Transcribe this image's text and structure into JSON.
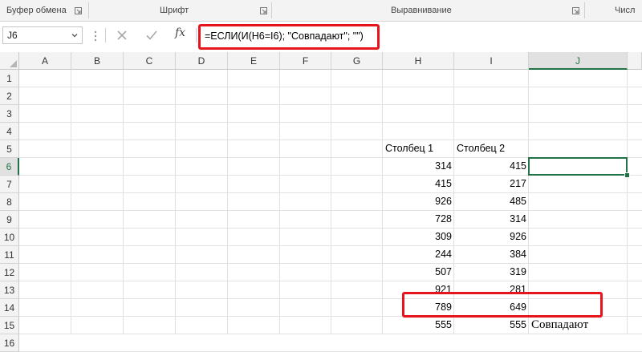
{
  "ribbon": {
    "groups": [
      "Буфер обмена",
      "Шрифт",
      "Выравнивание",
      "Числ"
    ]
  },
  "formula_bar": {
    "name_box": "J6",
    "formula": "=ЕСЛИ(И(H6=I6); \"Совпадают\"; \"\")",
    "fx_label": "fx",
    "cancel_icon": "x-icon",
    "enter_icon": "check-icon"
  },
  "sheet": {
    "columns": [
      "A",
      "B",
      "C",
      "D",
      "E",
      "F",
      "G",
      "H",
      "I",
      "J"
    ],
    "rows": [
      "1",
      "2",
      "3",
      "4",
      "5",
      "6",
      "7",
      "8",
      "9",
      "10",
      "11",
      "12",
      "13",
      "14",
      "15",
      "16"
    ],
    "active_cell": "J6",
    "headers": {
      "h": "Столбец 1",
      "i": "Столбец 2"
    },
    "data": [
      {
        "row": "6",
        "h": "314",
        "i": "415",
        "j": ""
      },
      {
        "row": "7",
        "h": "415",
        "i": "217",
        "j": ""
      },
      {
        "row": "8",
        "h": "926",
        "i": "485",
        "j": ""
      },
      {
        "row": "9",
        "h": "728",
        "i": "314",
        "j": ""
      },
      {
        "row": "10",
        "h": "309",
        "i": "926",
        "j": ""
      },
      {
        "row": "11",
        "h": "244",
        "i": "384",
        "j": ""
      },
      {
        "row": "12",
        "h": "507",
        "i": "319",
        "j": ""
      },
      {
        "row": "13",
        "h": "921",
        "i": "281",
        "j": ""
      },
      {
        "row": "14",
        "h": "789",
        "i": "649",
        "j": ""
      },
      {
        "row": "15",
        "h": "555",
        "i": "555",
        "j": "Совпадают"
      }
    ]
  },
  "colors": {
    "accent": "#217346",
    "highlight": "#e8141c"
  }
}
